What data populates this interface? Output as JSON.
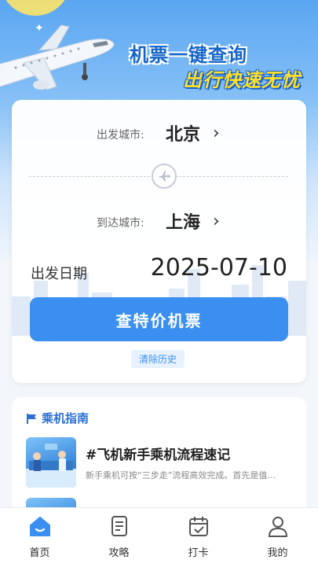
{
  "hero": {
    "headline_line1": "机票一键查询",
    "headline_line2": "出行快速无忧"
  },
  "search": {
    "depart_label": "出发城市:",
    "depart_city": "北京",
    "arrive_label": "到达城市:",
    "arrive_city": "上海",
    "date_label": "出发日期",
    "date_value": "2025-07-10",
    "search_button": "查特价机票",
    "clear_history": "清除历史"
  },
  "guide": {
    "title": "乘机指南",
    "articles": [
      {
        "title": "#飞机新手乘机流程速记",
        "desc": "新手乘机可按“三步走”流程高效完成。首先是值…"
      }
    ]
  },
  "tabbar": {
    "items": [
      {
        "label": "首页",
        "icon": "home-icon",
        "active": true
      },
      {
        "label": "攻略",
        "icon": "guide-doc-icon",
        "active": false
      },
      {
        "label": "打卡",
        "icon": "calendar-check-icon",
        "active": false
      },
      {
        "label": "我的",
        "icon": "profile-icon",
        "active": false
      }
    ]
  },
  "colors": {
    "accent": "#3a8ff0",
    "headline_blue": "#1565c9",
    "headline_yellow": "#ffe12a"
  }
}
